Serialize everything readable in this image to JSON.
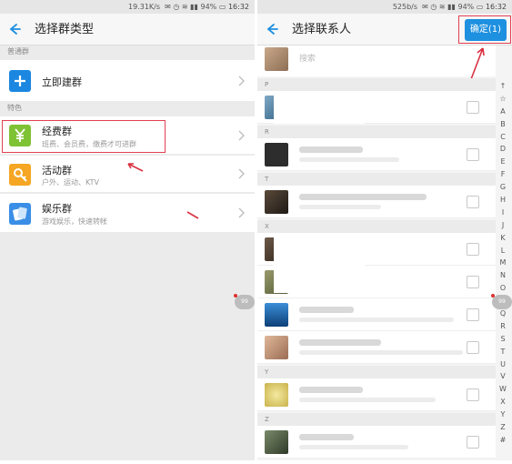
{
  "left": {
    "status": {
      "speed": "19.31K/s",
      "battery": "94%",
      "time": "16:32"
    },
    "title": "选择群类型",
    "sections": [
      {
        "label": "普通群"
      },
      {
        "label": "特色"
      }
    ],
    "rows": [
      {
        "name": "立即建群",
        "desc": "",
        "icon": "plus-icon",
        "color": "#1b87e0"
      },
      {
        "name": "经费群",
        "desc": "班费、会员费，缴费才可进群",
        "icon": "yuan-icon",
        "color": "#7fc234"
      },
      {
        "name": "活动群",
        "desc": "户外、运动、KTV",
        "icon": "key-icon",
        "color": "#f5a623"
      },
      {
        "name": "娱乐群",
        "desc": "游戏娱乐，快速转帐",
        "icon": "cards-icon",
        "color": "#3a8ee6"
      }
    ]
  },
  "right": {
    "status": {
      "speed": "525b/s",
      "battery": "94%",
      "time": "16:32"
    },
    "title": "选择联系人",
    "confirm_label": "确定(1)",
    "search_placeholder": "搜索",
    "groups": [
      {
        "letter": "P"
      },
      {
        "letter": "R"
      },
      {
        "letter": "T"
      },
      {
        "letter": "X"
      },
      {
        "letter": "Y"
      },
      {
        "letter": "Z"
      }
    ],
    "index_letters": [
      "↑",
      "☆",
      "A",
      "B",
      "C",
      "D",
      "E",
      "F",
      "G",
      "H",
      "I",
      "J",
      "K",
      "L",
      "M",
      "N",
      "O",
      "P",
      "Q",
      "R",
      "S",
      "T",
      "U",
      "V",
      "W",
      "X",
      "Y",
      "Z",
      "#"
    ]
  }
}
